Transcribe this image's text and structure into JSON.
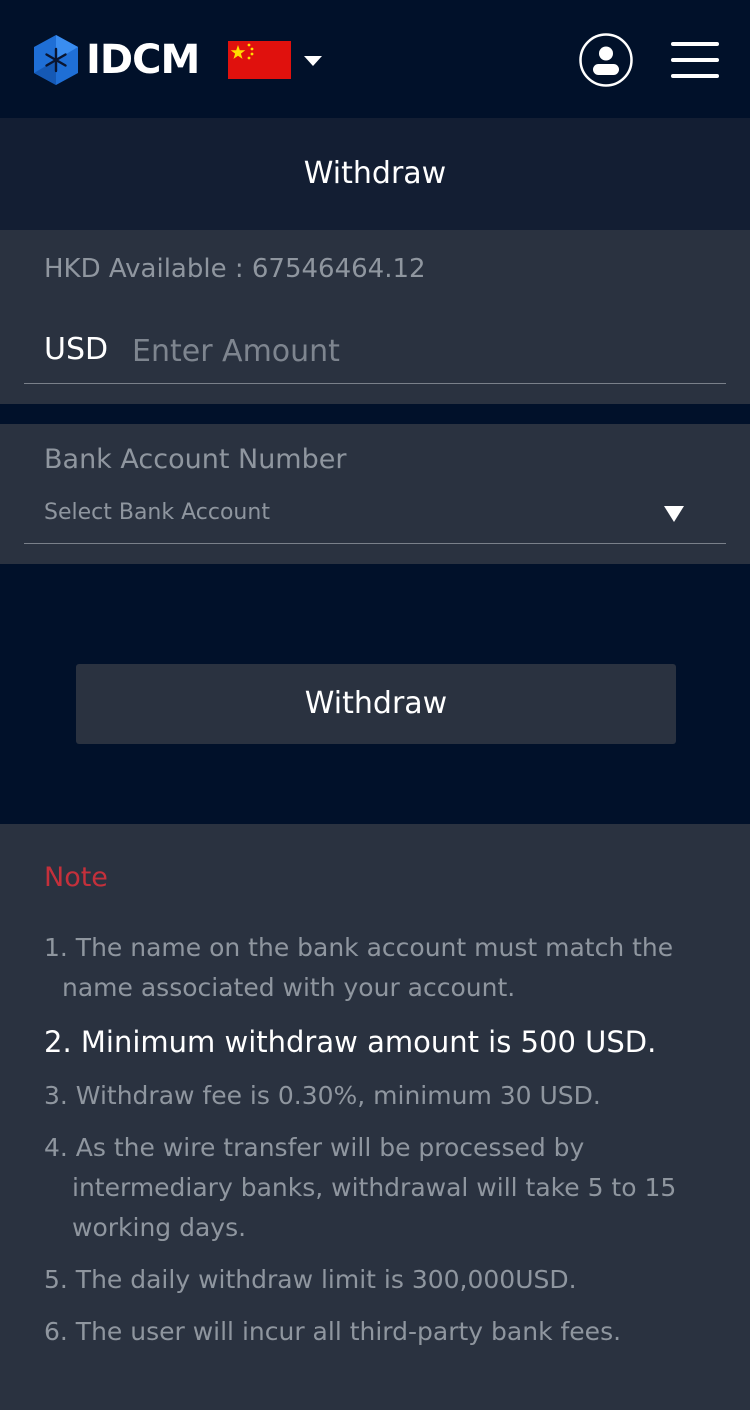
{
  "header": {
    "brand": "IDCM",
    "logo_icon": "idcm-logo-icon",
    "flag_icon": "china-flag-icon",
    "language_caret_icon": "caret-down-icon",
    "account_icon": "user-account-icon",
    "menu_icon": "hamburger-menu-icon"
  },
  "page_title": "Withdraw",
  "form": {
    "available_text": "HKD Available : 67546464.12",
    "currency_label": "USD",
    "amount_placeholder": "Enter Amount",
    "bank_account_label": "Bank Account Number",
    "bank_account_select": "Select Bank Account",
    "bank_caret_icon": "triangle-down-icon",
    "submit_label": "Withdraw"
  },
  "notes": {
    "title": "Note",
    "items": [
      {
        "line1": "1. The name on the bank account must match the",
        "line2": "name associated with your account."
      },
      {
        "line1": "2. Minimum withdraw amount is 500 USD."
      },
      {
        "line1": "3. Withdraw fee is 0.30%, minimum 30 USD."
      },
      {
        "line1": "4. As the wire transfer will be processed by",
        "line2": "intermediary banks, withdrawal will take 5 to 15",
        "line3": "working days."
      },
      {
        "line1": "5. The daily withdraw limit is 300,000USD."
      },
      {
        "line1": "6. The user will incur all third-party bank fees."
      }
    ]
  },
  "colors": {
    "background": "#01112a",
    "title_bar": "#131e33",
    "panel": "#2a3240",
    "note_title": "#c4303b",
    "muted_text": "#8f969f",
    "logo_blue": "#1f6fd6"
  }
}
